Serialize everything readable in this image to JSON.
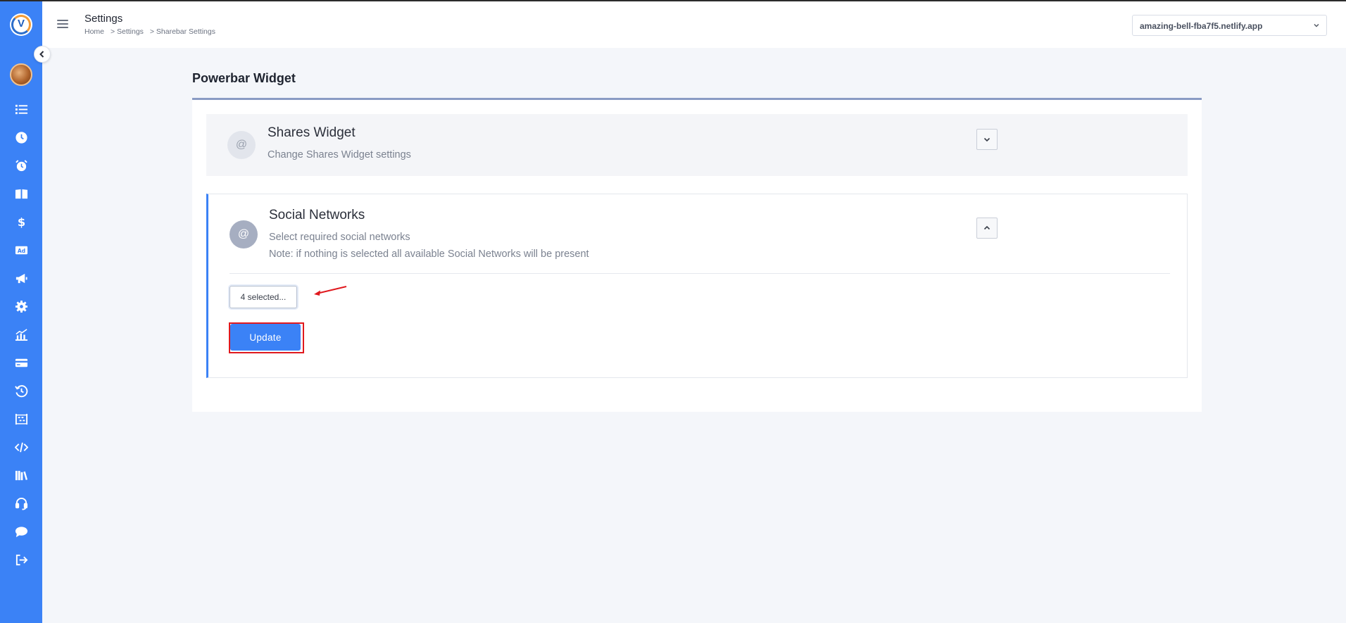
{
  "header": {
    "page_title": "Settings",
    "breadcrumb": [
      "Home",
      "> Settings",
      "> Sharebar Settings"
    ],
    "site_selector": {
      "value": "amazing-bell-fba7f5.netlify.app"
    }
  },
  "sidebar": {
    "logo_letter": "V",
    "icons": [
      "list-icon",
      "clock-icon",
      "alarm-icon",
      "book-icon",
      "dollar-icon",
      "ad-icon",
      "megaphone-icon",
      "gear-icon",
      "chart-icon",
      "credit-card-icon",
      "history-icon",
      "abacus-icon",
      "code-icon",
      "library-icon",
      "headset-icon",
      "chat-icon",
      "logout-icon"
    ],
    "accent_color": "#3b82f6"
  },
  "main": {
    "title": "Powerbar Widget",
    "panels": [
      {
        "icon_glyph": "@",
        "title": "Shares Widget",
        "subtitle": "Change Shares Widget settings",
        "expanded": false
      },
      {
        "icon_glyph": "@",
        "title": "Social Networks",
        "subtitle": "Select required social networks",
        "note": "Note: if nothing is selected all available Social Networks will be present",
        "expanded": true,
        "multi_select_value": "4 selected...",
        "update_label": "Update"
      }
    ]
  },
  "annotations": {
    "highlight_color": "#e0191e"
  }
}
